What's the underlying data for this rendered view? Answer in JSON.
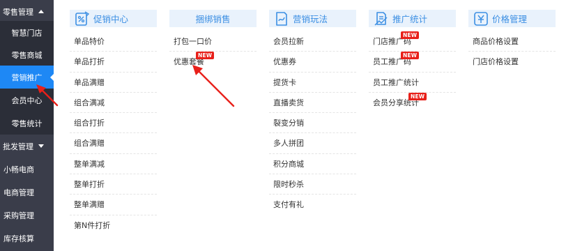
{
  "colors": {
    "sidebar_bg": "#3a3d4a",
    "sidebar_sub_bg": "#2b2e38",
    "sidebar_active": "#1e88f5",
    "header_bg": "#e9f2fc",
    "header_text": "#3c8fe3",
    "badge": "#e8201a",
    "annotation_arrow": "#e8201a"
  },
  "sidebar": {
    "retail_group": {
      "label": "零售管理",
      "expanded": true
    },
    "retail_items": [
      {
        "label": "智慧门店"
      },
      {
        "label": "零售商城"
      },
      {
        "label": "营销推广",
        "active": true
      },
      {
        "label": "会员中心"
      },
      {
        "label": "零售统计"
      }
    ],
    "wholesale_group": {
      "label": "批发管理",
      "expanded": false
    },
    "top_items": [
      {
        "label": "小畅电商"
      },
      {
        "label": "电商管理"
      },
      {
        "label": "采购管理"
      },
      {
        "label": "库存核算"
      }
    ]
  },
  "columns": [
    {
      "title": "促销中心",
      "icon": "promotion-center-icon",
      "items": [
        {
          "label": "单品特价"
        },
        {
          "label": "单品打折"
        },
        {
          "label": "单品满赠"
        },
        {
          "label": "组合满减"
        },
        {
          "label": "组合打折"
        },
        {
          "label": "组合满赠"
        },
        {
          "label": "整单满减"
        },
        {
          "label": "整单打折"
        },
        {
          "label": "整单满赠"
        },
        {
          "label": "第N件打折"
        }
      ]
    },
    {
      "title": "捆绑销售",
      "icon": "",
      "items": [
        {
          "label": "打包一口价"
        },
        {
          "label": "优惠套餐",
          "badge": "NEW"
        }
      ]
    },
    {
      "title": "营销玩法",
      "icon": "marketing-play-icon",
      "items": [
        {
          "label": "会员拉新"
        },
        {
          "label": "优惠券"
        },
        {
          "label": "提货卡"
        },
        {
          "label": "直播卖货"
        },
        {
          "label": "裂变分销"
        },
        {
          "label": "多人拼团"
        },
        {
          "label": "积分商城"
        },
        {
          "label": "限时秒杀"
        },
        {
          "label": "支付有礼"
        }
      ]
    },
    {
      "title": "推广统计",
      "icon": "promotion-stats-icon",
      "items": [
        {
          "label": "门店推广码",
          "badge": "NEW"
        },
        {
          "label": "员工推广码",
          "badge": "NEW"
        },
        {
          "label": "员工推广统计"
        },
        {
          "label": "会员分享统计",
          "badge": "NEW"
        }
      ]
    },
    {
      "title": "价格管理",
      "icon": "price-management-icon",
      "items": [
        {
          "label": "商品价格设置"
        },
        {
          "label": "门店价格设置"
        }
      ]
    }
  ]
}
